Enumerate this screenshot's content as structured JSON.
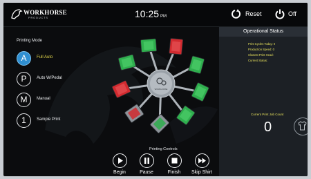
{
  "header": {
    "logo_text": "WORKHORSE",
    "logo_sub": "PRODUCTS",
    "time": "10:25",
    "ampm": "PM",
    "reset_label": "Reset",
    "off_label": "Off"
  },
  "printing_mode": {
    "title": "Printing Mode",
    "modes": [
      {
        "letter": "A",
        "label": "Full Auto",
        "active": true
      },
      {
        "letter": "P",
        "label": "Auto W/Pedal",
        "active": false
      },
      {
        "letter": "M",
        "label": "Manual",
        "active": false
      },
      {
        "letter": "1",
        "label": "Sample Print",
        "active": false
      }
    ]
  },
  "carousel": {
    "hub_label": "WORKHORSE",
    "platens": [
      {
        "color": "red"
      },
      {
        "color": "green"
      },
      {
        "color": "green"
      },
      {
        "color": "green"
      },
      {
        "color": "grey-green"
      },
      {
        "color": "grey-red"
      },
      {
        "color": "red"
      },
      {
        "color": "green"
      },
      {
        "color": "green"
      }
    ]
  },
  "status": {
    "title": "Operational Status",
    "lines": [
      "Print Cycles Today: 0",
      "Production Speed: 0",
      "Slowest Print Head:",
      "Current Status:"
    ],
    "count_label": "Current Print Job Count",
    "count_value": "0"
  },
  "controls": {
    "title": "Printing Controls",
    "buttons": [
      {
        "icon": "play-icon",
        "label": "Begin"
      },
      {
        "icon": "pause-icon",
        "label": "Pause"
      },
      {
        "icon": "stop-icon",
        "label": "Finish"
      },
      {
        "icon": "fast-forward-icon",
        "label": "Skip Shirt"
      }
    ]
  },
  "colors": {
    "accent_blue": "#2f8fd1",
    "status_yellow": "#e8e25c",
    "platen_red": "#d12a2f",
    "platen_green": "#2fae4e"
  }
}
